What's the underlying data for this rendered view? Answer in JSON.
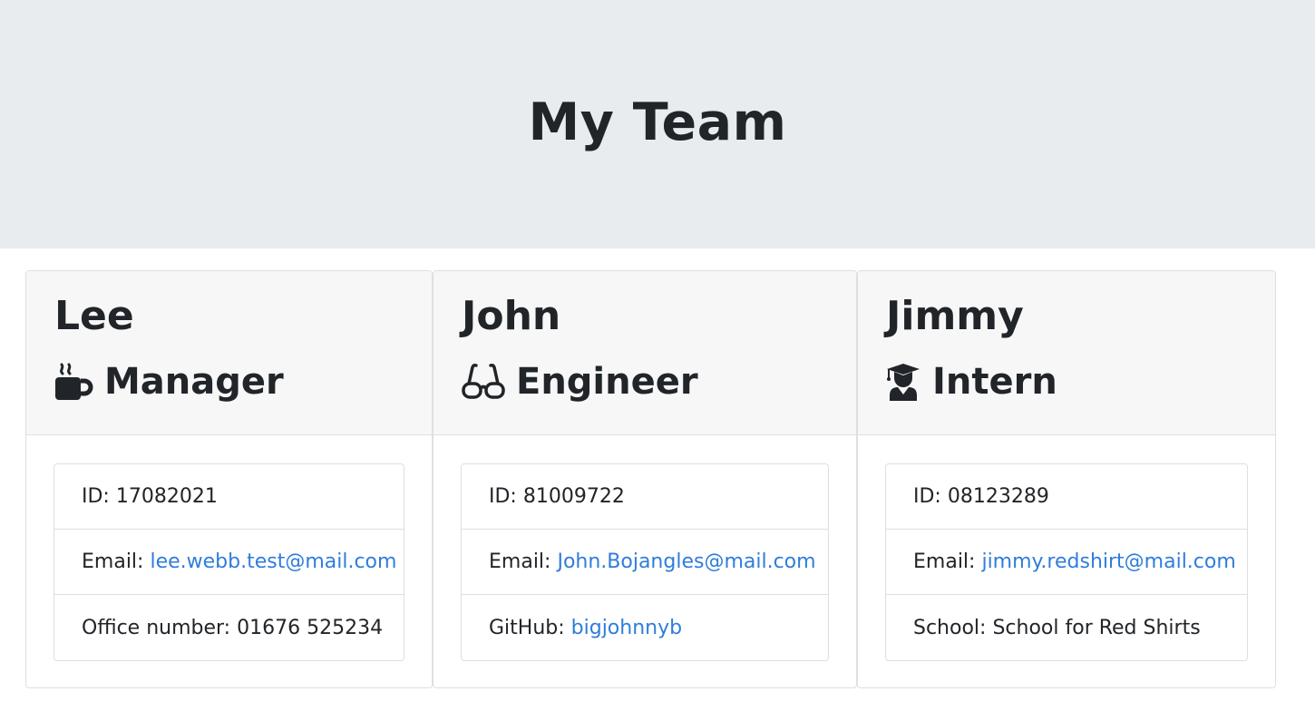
{
  "header": {
    "title": "My Team"
  },
  "colors": {
    "jumbotron_bg": "#e9ecef",
    "card_header_bg": "#f7f7f7",
    "link": "#2f7ddb",
    "text": "#212529"
  },
  "cards": [
    {
      "name": "Lee",
      "role": "Manager",
      "role_icon": "mug-hot-icon",
      "id_label": "ID:",
      "id_value": "17082021",
      "email_label": "Email:",
      "email_value": "lee.webb.test@mail.com",
      "extra_label": "Office number:",
      "extra_value": "01676 525234"
    },
    {
      "name": "John",
      "role": "Engineer",
      "role_icon": "glasses-icon",
      "id_label": "ID:",
      "id_value": "81009722",
      "email_label": "Email:",
      "email_value": "John.Bojangles@mail.com",
      "extra_label": "GitHub:",
      "extra_value": "bigjohnnyb"
    },
    {
      "name": "Jimmy",
      "role": "Intern",
      "role_icon": "user-graduate-icon",
      "id_label": "ID:",
      "id_value": "08123289",
      "email_label": "Email:",
      "email_value": "jimmy.redshirt@mail.com",
      "extra_label": "School:",
      "extra_value": "School for Red Shirts"
    }
  ]
}
